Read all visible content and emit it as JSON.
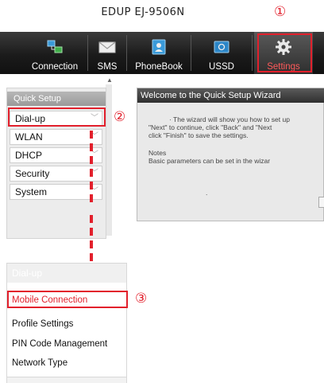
{
  "title": "EDUP EJ-9506N",
  "callouts": {
    "one": "①",
    "two": "②",
    "three": "③"
  },
  "nav": [
    {
      "label": "Connection",
      "icon": "connection-icon"
    },
    {
      "label": "SMS",
      "icon": "envelope-icon"
    },
    {
      "label": "PhoneBook",
      "icon": "phonebook-icon"
    },
    {
      "label": "USSD",
      "icon": "ussd-icon"
    },
    {
      "label": "Settings",
      "icon": "gear-icon"
    }
  ],
  "sidebar": {
    "header": "Quick Setup",
    "items": [
      {
        "label": "Dial-up"
      },
      {
        "label": "WLAN"
      },
      {
        "label": "DHCP"
      },
      {
        "label": "Security"
      },
      {
        "label": "System"
      }
    ]
  },
  "wizard": {
    "title": "Welcome to the Quick Setup Wizard",
    "line1": "·  The wizard will show you how to set up",
    "line2": "\"Next\" to continue, click \"Back\" and \"Next",
    "line3": "click \"Finish\" to save the settings.",
    "notes_label": "Notes",
    "notes_text": "Basic parameters can be set in the wizar",
    "dot": "."
  },
  "submenu": {
    "header": "Dial-up",
    "items": [
      {
        "label": "Mobile Connection",
        "active": true
      },
      {
        "label": "Profile Settings"
      },
      {
        "label": "PIN Code Management"
      },
      {
        "label": "Network Type"
      }
    ]
  },
  "colors": {
    "accent": "#e2202c",
    "navbar": "#1b1b1b"
  }
}
